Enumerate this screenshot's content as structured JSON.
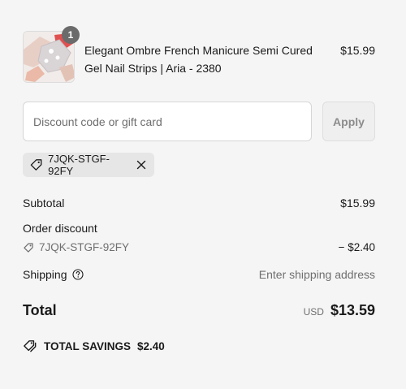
{
  "product": {
    "quantity": "1",
    "name": "Elegant Ombre French Manicure Semi Cured Gel Nail Strips | Aria - 2380",
    "price": "$15.99"
  },
  "discount": {
    "placeholder": "Discount code or gift card",
    "apply_label": "Apply",
    "applied_code": "7JQK-STGF-92FY"
  },
  "summary": {
    "subtotal_label": "Subtotal",
    "subtotal_value": "$15.99",
    "order_discount_label": "Order discount",
    "discount_code": "7JQK-STGF-92FY",
    "discount_value": "− $2.40",
    "shipping_label": "Shipping",
    "shipping_value": "Enter shipping address",
    "total_label": "Total",
    "currency": "USD",
    "total_value": "$13.59",
    "savings_label": "TOTAL SAVINGS",
    "savings_value": "$2.40"
  },
  "icons": {
    "tag": "tag-icon",
    "close": "close-icon",
    "help": "question-circle-icon",
    "savings": "savings-tag-icon"
  },
  "colors": {
    "background": "#f5f5f5",
    "text": "#1a1a1a",
    "muted": "#6f6f6f"
  }
}
